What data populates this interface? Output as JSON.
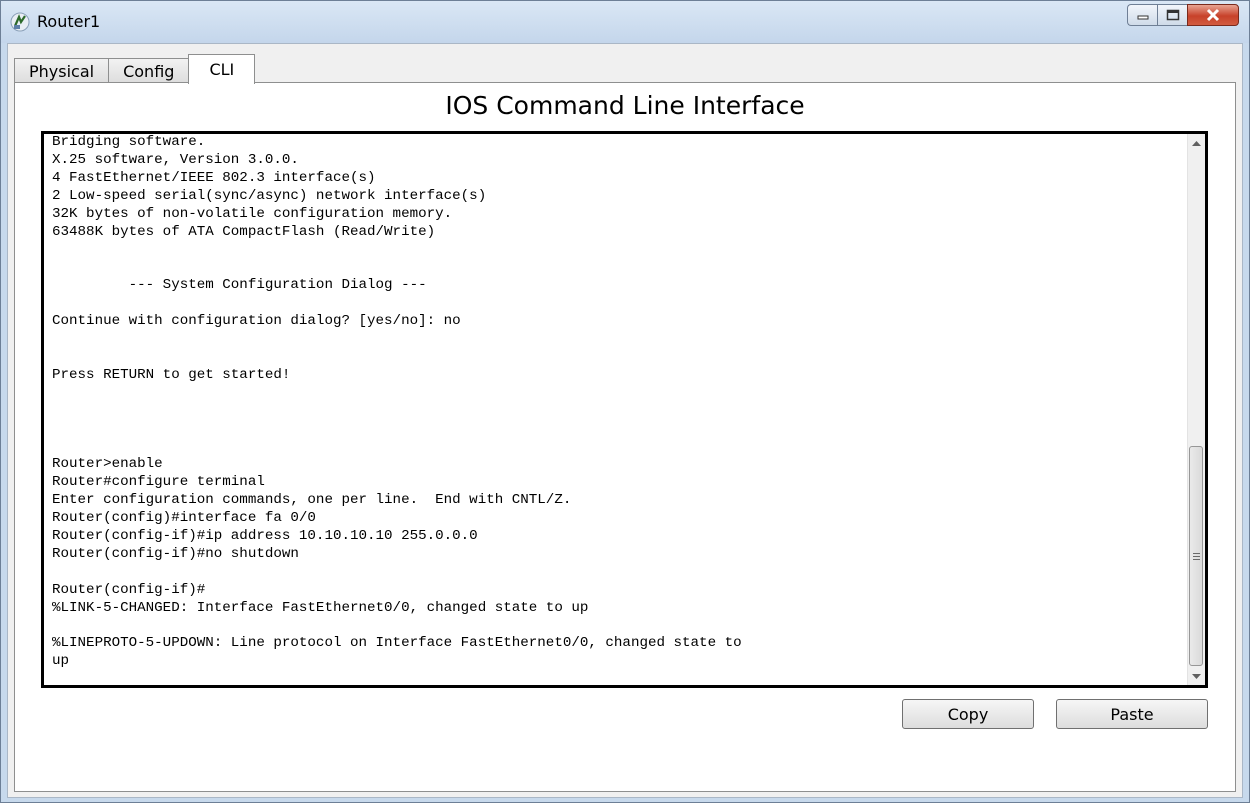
{
  "window": {
    "title": "Router1"
  },
  "tabs": [
    {
      "label": "Physical"
    },
    {
      "label": "Config"
    },
    {
      "label": "CLI"
    }
  ],
  "cli": {
    "heading": "IOS Command Line Interface",
    "output": "Bridging software.\nX.25 software, Version 3.0.0.\n4 FastEthernet/IEEE 802.3 interface(s)\n2 Low-speed serial(sync/async) network interface(s)\n32K bytes of non-volatile configuration memory.\n63488K bytes of ATA CompactFlash (Read/Write)\n\n\n         --- System Configuration Dialog ---\n\nContinue with configuration dialog? [yes/no]: no\n\n\nPress RETURN to get started!\n\n\n\n\nRouter>enable\nRouter#configure terminal\nEnter configuration commands, one per line.  End with CNTL/Z.\nRouter(config)#interface fa 0/0\nRouter(config-if)#ip address 10.10.10.10 255.0.0.0\nRouter(config-if)#no shutdown\n\nRouter(config-if)#\n%LINK-5-CHANGED: Interface FastEthernet0/0, changed state to up\n\n%LINEPROTO-5-UPDOWN: Line protocol on Interface FastEthernet0/0, changed state to\nup"
  },
  "buttons": {
    "copy": "Copy",
    "paste": "Paste"
  }
}
